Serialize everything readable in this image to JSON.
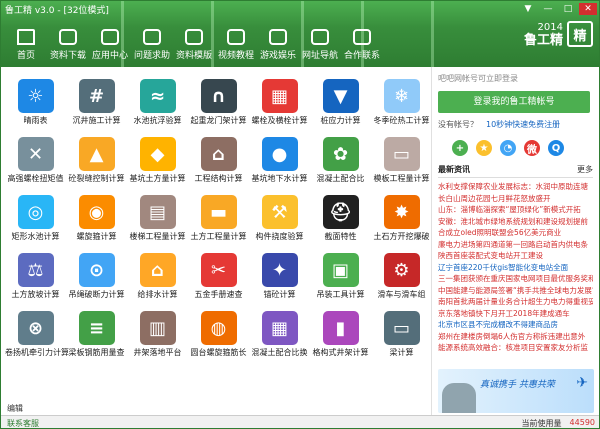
{
  "window": {
    "title": "鲁工精 v3.0 - [32位模式]",
    "controls": [
      "▼",
      "—",
      "□",
      "✕"
    ]
  },
  "nav": [
    {
      "label": "首页",
      "icon": "home-icon"
    },
    {
      "label": "资料下载",
      "icon": "download-icon"
    },
    {
      "label": "应用中心",
      "icon": "apps-icon"
    },
    {
      "label": "问题求助",
      "icon": "help-icon"
    },
    {
      "label": "资料模版",
      "icon": "template-icon"
    },
    {
      "label": "视频教程",
      "icon": "video-icon"
    },
    {
      "label": "游戏娱乐",
      "icon": "game-icon"
    },
    {
      "label": "网址导航",
      "icon": "nav-icon"
    },
    {
      "label": "合作联系",
      "icon": "contact-icon"
    }
  ],
  "brand": {
    "year": "2014",
    "name": "鲁工精",
    "logo": "精"
  },
  "tools": [
    {
      "label": "晴雨表",
      "color": "#1e88e5",
      "glyph": "☼"
    },
    {
      "label": "沉井施工计算",
      "color": "#546e7a",
      "glyph": "#"
    },
    {
      "label": "水池抗浮验算",
      "color": "#26a69a",
      "glyph": "≈"
    },
    {
      "label": "起重龙门架计算",
      "color": "#37474f",
      "glyph": "∩"
    },
    {
      "label": "螺栓及横栓计算",
      "color": "#e53935",
      "glyph": "▦"
    },
    {
      "label": "桩应力计算",
      "color": "#1565c0",
      "glyph": "▼"
    },
    {
      "label": "冬季砼热工计算",
      "color": "#90caf9",
      "glyph": "❄"
    },
    {
      "label": "高强螺栓扭矩值",
      "color": "#78909c",
      "glyph": "✕"
    },
    {
      "label": "砼裂缝控制计算",
      "color": "#f9a825",
      "glyph": "▲"
    },
    {
      "label": "基坑土方量计算",
      "color": "#ffb300",
      "glyph": "◆"
    },
    {
      "label": "工程结构计算",
      "color": "#8d6e63",
      "glyph": "⌂"
    },
    {
      "label": "基坑地下水计算",
      "color": "#1e88e5",
      "glyph": "●"
    },
    {
      "label": "混凝土配合比",
      "color": "#43a047",
      "glyph": "✿"
    },
    {
      "label": "模板工程量计算",
      "color": "#bcaaa4",
      "glyph": "▭"
    },
    {
      "label": "矩形水池计算",
      "color": "#29b6f6",
      "glyph": "◎"
    },
    {
      "label": "螺旋箍计算",
      "color": "#fb8c00",
      "glyph": "◉"
    },
    {
      "label": "楼梯工程量计算",
      "color": "#a1887f",
      "glyph": "▤"
    },
    {
      "label": "土方工程量计算",
      "color": "#f9a825",
      "glyph": "▬"
    },
    {
      "label": "构件挠度验算",
      "color": "#fbc02d",
      "glyph": "⚒"
    },
    {
      "label": "截面特性",
      "color": "#212121",
      "glyph": "⛑"
    },
    {
      "label": "土石方开挖爆破",
      "color": "#ef6c00",
      "glyph": "✸"
    },
    {
      "label": "土方放坡计算",
      "color": "#5c6bc0",
      "glyph": "⚖"
    },
    {
      "label": "吊绳破断力计算",
      "color": "#42a5f5",
      "glyph": "⊙"
    },
    {
      "label": "给排水计算",
      "color": "#ffa726",
      "glyph": "⌂"
    },
    {
      "label": "五金手册速查",
      "color": "#e53935",
      "glyph": "✂"
    },
    {
      "label": "锚砼计算",
      "color": "#3949ab",
      "glyph": "✦"
    },
    {
      "label": "吊装工具计算",
      "color": "#4caf50",
      "glyph": "▣"
    },
    {
      "label": "滑车与滑车组",
      "color": "#c62828",
      "glyph": "⚙"
    },
    {
      "label": "卷扬机牵引力计算",
      "color": "#607d8b",
      "glyph": "⊗"
    },
    {
      "label": "梁板钢筋用量查",
      "color": "#43a047",
      "glyph": "≡"
    },
    {
      "label": "井架落地平台",
      "color": "#8d6e63",
      "glyph": "▥"
    },
    {
      "label": "圆台螺旋箍筋长",
      "color": "#ef6c00",
      "glyph": "◍"
    },
    {
      "label": "混凝土配合比换",
      "color": "#7e57c2",
      "glyph": "▦"
    },
    {
      "label": "格构式井架计算",
      "color": "#ab47bc",
      "glyph": "▮"
    },
    {
      "label": "梁计算",
      "color": "#546e7a",
      "glyph": "▭"
    }
  ],
  "editbar": "编辑",
  "panel": {
    "hint": "吧吧网帐号可立即登录",
    "login": "登录我的鲁工精帐号",
    "no_account": "没有帐号？",
    "register": "10秒钟快速免费注册",
    "social": [
      {
        "icon": "add-icon",
        "glyph": "+",
        "color": "#4caf50"
      },
      {
        "icon": "star-icon",
        "glyph": "★",
        "color": "#fbc02d"
      },
      {
        "icon": "circle-icon",
        "glyph": "◔",
        "color": "#42a5f5"
      },
      {
        "icon": "weibo-icon",
        "glyph": "微",
        "color": "#e53935"
      },
      {
        "icon": "tencent-icon",
        "glyph": "Q",
        "color": "#1e88e5"
      }
    ],
    "news_title": "最新资讯",
    "more": "更多",
    "news": [
      {
        "text": "水利支撑保障农业发展标志：水润中原助连塘",
        "blue": false
      },
      {
        "text": "长白山周边花园七月鲜花怒放盛开",
        "blue": false
      },
      {
        "text": "山东：淄博临淄探索“屋顶绿化”新模式开拓",
        "blue": false
      },
      {
        "text": "安徽：淮北城市绿地系统规划和建设规划提前",
        "blue": false
      },
      {
        "text": "合成立oled照明联盟会56亿美元商业",
        "blue": false
      },
      {
        "text": "廉电力进场第四通道第一回路启动首内供电条",
        "blue": false
      },
      {
        "text": "陕西首座装配式变电站开工建设",
        "blue": false
      },
      {
        "text": "辽宁首座220千伏gis智能化变电站全面",
        "blue": true
      },
      {
        "text": "三一集团获颁在重庆国家电网项目最优服务奖和省可",
        "blue": false
      },
      {
        "text": "中国能建与能源局签署“携手共推全球电力发展”",
        "blue": false
      },
      {
        "text": "南阳首批两届计量业务合计超生力电力得重视妥",
        "blue": false
      },
      {
        "text": "京东落地镇快下月开工2018年建成通车",
        "blue": false
      },
      {
        "text": "北京市区县不完成棚改不得建商品房",
        "blue": true
      },
      {
        "text": "郑州在建楼房倒塌6人伤官方称拆违建出意外",
        "blue": false
      },
      {
        "text": "能源系统高效融合：核准项目安置家友分析监",
        "blue": false
      }
    ],
    "banner_slogan": "真诚携手 共惠共荣"
  },
  "status": {
    "contact": "联系客服",
    "label": "当前使用量",
    "count": "44590"
  }
}
